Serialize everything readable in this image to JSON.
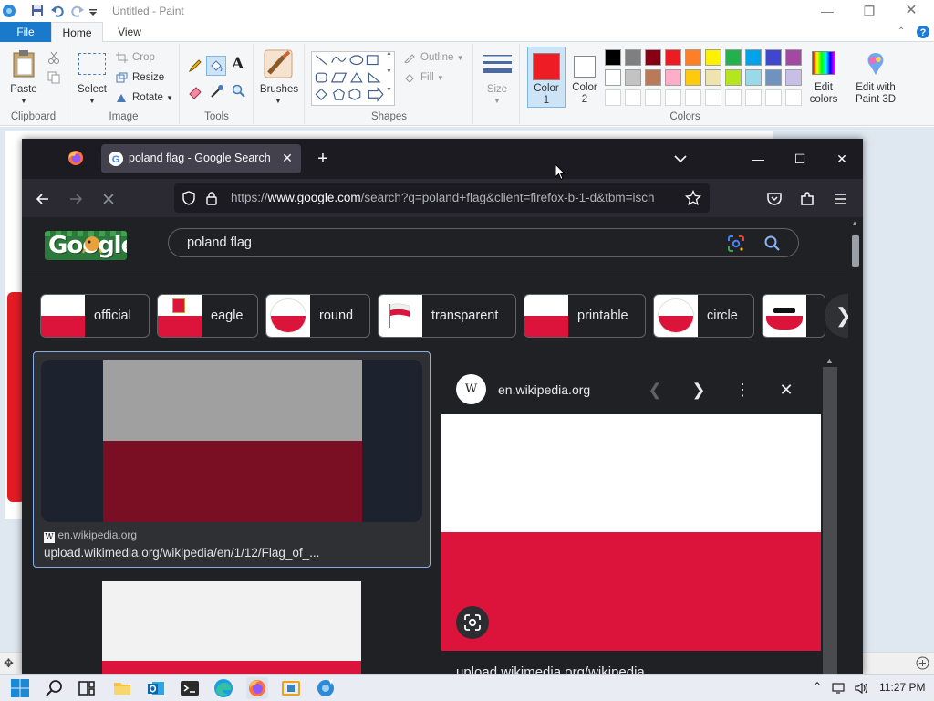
{
  "paint": {
    "title": "Untitled - Paint",
    "tabs": {
      "file": "File",
      "home": "Home",
      "view": "View"
    },
    "clipboard": {
      "paste": "Paste",
      "group": "Clipboard"
    },
    "image": {
      "select": "Select",
      "crop": "Crop",
      "resize": "Resize",
      "rotate": "Rotate",
      "group": "Image"
    },
    "tools": {
      "group": "Tools"
    },
    "brushes": {
      "label": "Brushes"
    },
    "shapes": {
      "outline": "Outline",
      "fill": "Fill",
      "group": "Shapes"
    },
    "size": {
      "label": "Size"
    },
    "colors": {
      "color1": "Color\n1",
      "color1_a": "Color",
      "color1_b": "1",
      "color2_a": "Color",
      "color2_b": "2",
      "edit_a": "Edit",
      "edit_b": "colors",
      "paint3d_a": "Edit with",
      "paint3d_b": "Paint 3D",
      "group": "Colors",
      "color1_value": "#ee1c24",
      "palette_row1": [
        "#000000",
        "#7f7f7f",
        "#880015",
        "#ed1c24",
        "#ff7f27",
        "#fff200",
        "#22b14c",
        "#00a2e8",
        "#3f48cc",
        "#a349a4"
      ],
      "palette_row2": [
        "#ffffff",
        "#c3c3c3",
        "#b97a57",
        "#ffaec9",
        "#ffc90e",
        "#efe4b0",
        "#b5e61d",
        "#99d9ea",
        "#7092be",
        "#c8bfe7"
      ]
    }
  },
  "firefox": {
    "tab_title": "poland flag - Google Search",
    "url_prefix": "https://",
    "url_domain": "www.google.com",
    "url_rest": "/search?q=poland+flag&client=firefox-b-1-d&tbm=isch"
  },
  "google": {
    "logo": "Google",
    "query": "poland flag",
    "chips": [
      "official",
      "eagle",
      "round",
      "transparent",
      "printable",
      "circle"
    ],
    "result": {
      "source": "en.wikipedia.org",
      "url": "upload.wikimedia.org/wikipedia/en/1/12/Flag_of_..."
    },
    "preview": {
      "logo": "W",
      "domain": "en.wikipedia.org",
      "bottom_text": "upload.wikimedia.org/wikipedia"
    }
  },
  "taskbar": {
    "time": "11:27 PM"
  },
  "icons": {
    "paint_app": "paint-icon",
    "save": "save-icon",
    "undo": "undo-icon",
    "redo": "redo-icon",
    "help": "help-icon",
    "firefox": "firefox-icon",
    "google": "google-g-icon",
    "back": "back-arrow-icon",
    "forward": "forward-arrow-icon",
    "loading": "loading-icon",
    "shield": "shield-icon",
    "lock": "lock-icon",
    "star": "bookmark-star-icon",
    "pocket": "pocket-icon",
    "extensions": "extensions-icon",
    "menu": "hamburger-menu-icon",
    "lens": "google-lens-icon",
    "search": "search-icon"
  }
}
